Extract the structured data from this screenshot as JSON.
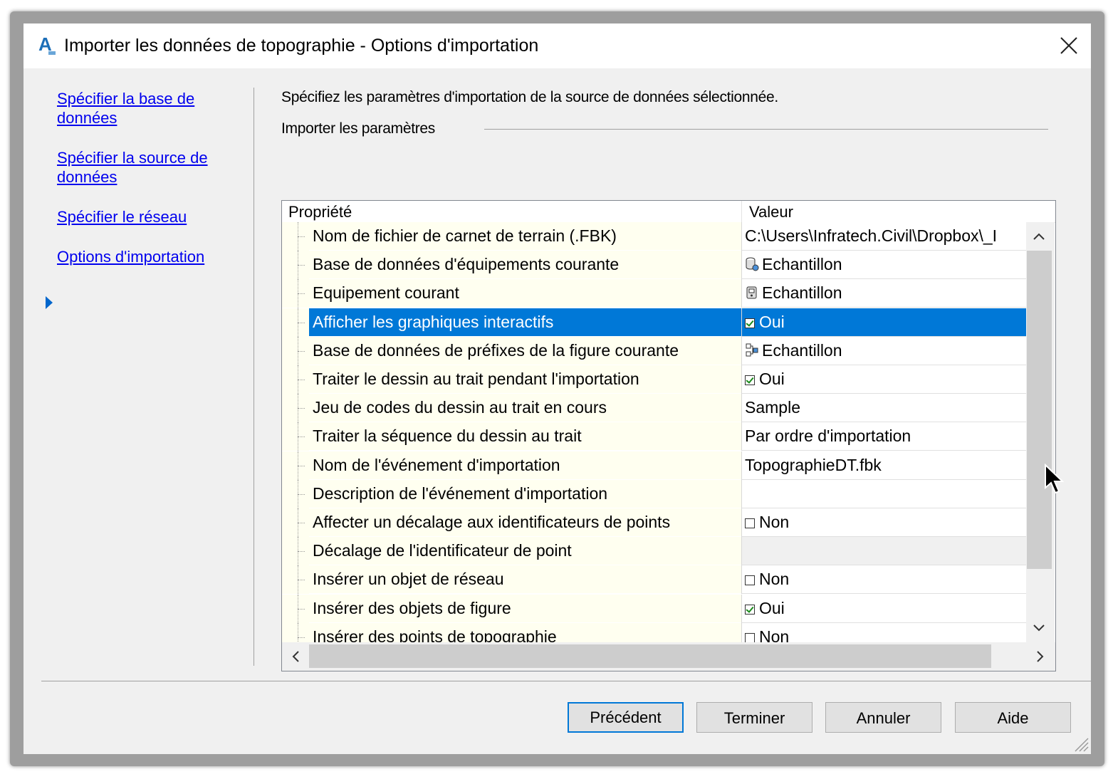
{
  "window": {
    "title": "Importer les données de topographie - Options d'importation",
    "app_icon_letter": "A"
  },
  "nav": {
    "items": [
      {
        "label_line1": "Spécifier la base de ",
        "label_line2": "données"
      },
      {
        "label_line1": "Spécifier la source de ",
        "label_line2": "données"
      },
      {
        "label_line1": "Spécifier le réseau"
      },
      {
        "label_line1": "Options d'importation",
        "current": true
      }
    ]
  },
  "main": {
    "instruction": "Spécifiez les paramètres d'importation de la source de données sélectionnée.",
    "group_label": "Importer les paramètres"
  },
  "grid": {
    "col_property": "Propriété",
    "col_value": "Valeur",
    "rows": [
      {
        "name": "Nom de fichier de carnet de terrain (.FBK)",
        "value": "C:\\Users\\Infratech.Civil\\Dropbox\\_I"
      },
      {
        "name": "Base de données d'équipements courante",
        "value": "Echantillon",
        "icon": "database-icon"
      },
      {
        "name": "Equipement courant",
        "value": "Echantillon",
        "icon": "equipment-icon"
      },
      {
        "name": "Afficher les graphiques interactifs",
        "value": "Oui",
        "checkbox": true,
        "checked": true,
        "selected": true
      },
      {
        "name": "Base de données de préfixes de la figure courante",
        "value": "Echantillon",
        "icon": "figure-prefix-icon"
      },
      {
        "name": "Traiter le dessin au trait pendant l'importation",
        "value": "Oui",
        "checkbox": true,
        "checked": true
      },
      {
        "name": "Jeu de codes du dessin au trait en cours",
        "value": "Sample"
      },
      {
        "name": "Traiter la séquence du dessin au trait",
        "value": "Par ordre d'importation"
      },
      {
        "name": "Nom de l'événement d'importation",
        "value": "TopographieDT.fbk"
      },
      {
        "name": "Description de l'événement d'importation",
        "value": ""
      },
      {
        "name": "Affecter un décalage aux identificateurs de points",
        "value": "Non",
        "checkbox": true,
        "checked": false
      },
      {
        "name": "Décalage de l'identificateur de point",
        "value": "",
        "readonly": true
      },
      {
        "name": "Insérer un objet de réseau",
        "value": "Non",
        "checkbox": true,
        "checked": false
      },
      {
        "name": "Insérer des objets de figure",
        "value": "Oui",
        "checkbox": true,
        "checked": true
      },
      {
        "name": "Insérer des points de topographie",
        "value": "Non",
        "checkbox": true,
        "checked": false
      }
    ]
  },
  "buttons": {
    "back": "Précédent",
    "finish": "Terminer",
    "cancel": "Annuler",
    "help": "Aide"
  },
  "colors": {
    "selection": "#0078d7",
    "link": "#0000ee",
    "property_background": "#fffff0"
  }
}
